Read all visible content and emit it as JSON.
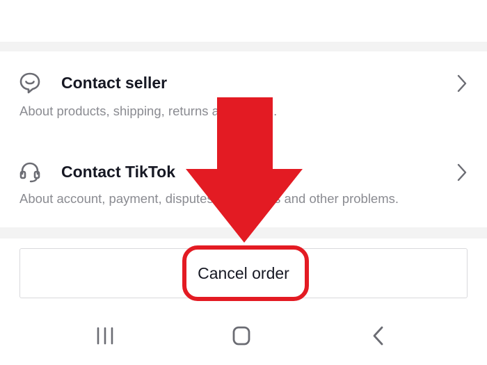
{
  "rows": [
    {
      "title": "Contact seller",
      "subtitle": "About products, shipping, returns and refund.",
      "icon": "chat-bubble-smile-icon"
    },
    {
      "title": "Contact TikTok",
      "subtitle": "About account, payment, disputes with sellers and other problems.",
      "icon": "headset-icon"
    }
  ],
  "cancel_button": {
    "label": "Cancel order"
  },
  "annotation": {
    "color": "#e31b23"
  },
  "navbar": {
    "items": [
      "recent-apps-icon",
      "home-icon",
      "back-icon"
    ]
  }
}
